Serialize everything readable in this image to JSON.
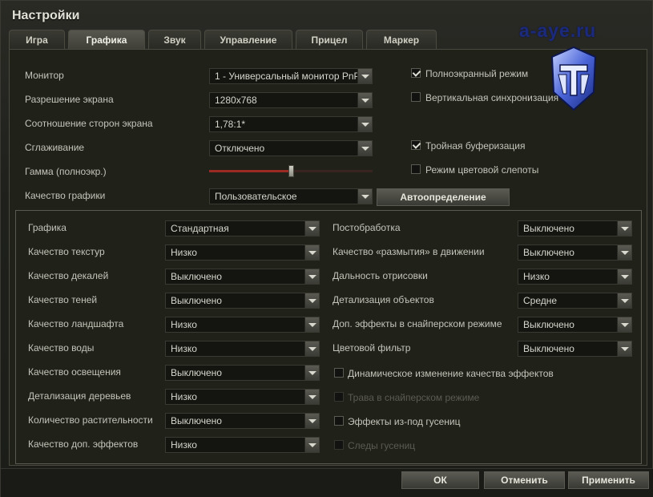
{
  "window": {
    "title": "Настройки"
  },
  "watermark": "a-aye.ru",
  "tabs": [
    {
      "label": "Игра",
      "active": false
    },
    {
      "label": "Графика",
      "active": true
    },
    {
      "label": "Звук",
      "active": false
    },
    {
      "label": "Управление",
      "active": false
    },
    {
      "label": "Прицел",
      "active": false
    },
    {
      "label": "Маркер",
      "active": false
    }
  ],
  "general": {
    "monitor": {
      "label": "Монитор",
      "value": "1 - Универсальный монитор PnP"
    },
    "resolution": {
      "label": "Разрешение экрана",
      "value": "1280x768"
    },
    "aspect": {
      "label": "Соотношение сторон экрана",
      "value": "1,78:1*"
    },
    "antialiasing": {
      "label": "Сглаживание",
      "value": "Отключено"
    },
    "gamma": {
      "label": "Гамма (полноэкр.)",
      "level": 0.5
    },
    "quality": {
      "label": "Качество графики",
      "value": "Пользовательское"
    },
    "autodetect": "Автоопределение"
  },
  "checks": {
    "fullscreen": {
      "label": "Полноэкранный режим",
      "checked": true
    },
    "vsync": {
      "label": "Вертикальная синхронизация",
      "checked": false
    },
    "triple": {
      "label": "Тройная буферизация",
      "checked": true
    },
    "colorblind": {
      "label": "Режим цветовой слепоты",
      "checked": false
    }
  },
  "advanced_left": [
    {
      "label": "Графика",
      "value": "Стандартная"
    },
    {
      "label": "Качество текстур",
      "value": "Низко"
    },
    {
      "label": "Качество декалей",
      "value": "Выключено"
    },
    {
      "label": "Качество теней",
      "value": "Выключено"
    },
    {
      "label": "Качество ландшафта",
      "value": "Низко"
    },
    {
      "label": "Качество воды",
      "value": "Низко"
    },
    {
      "label": "Качество освещения",
      "value": "Выключено"
    },
    {
      "label": "Детализация деревьев",
      "value": "Низко"
    },
    {
      "label": "Количество растительности",
      "value": "Выключено"
    },
    {
      "label": "Качество доп. эффектов",
      "value": "Низко"
    }
  ],
  "advanced_right": [
    {
      "label": "Постобработка",
      "value": "Выключено"
    },
    {
      "label": "Качество «размытия» в движении",
      "value": "Выключено"
    },
    {
      "label": "Дальность отрисовки",
      "value": "Низко"
    },
    {
      "label": "Детализация объектов",
      "value": "Средне"
    },
    {
      "label": "Доп. эффекты в снайперском режиме",
      "value": "Выключено"
    },
    {
      "label": "Цветовой фильтр",
      "value": "Выключено"
    }
  ],
  "advanced_checks": [
    {
      "label": "Динамическое изменение качества эффектов",
      "checked": false,
      "disabled": false
    },
    {
      "label": "Трава в снайперском режиме",
      "checked": false,
      "disabled": true
    },
    {
      "label": "Эффекты из-под гусениц",
      "checked": false,
      "disabled": false
    },
    {
      "label": "Следы гусениц",
      "checked": false,
      "disabled": true
    }
  ],
  "buttons": {
    "ok": "ОК",
    "cancel": "Отменить",
    "apply": "Применить"
  }
}
